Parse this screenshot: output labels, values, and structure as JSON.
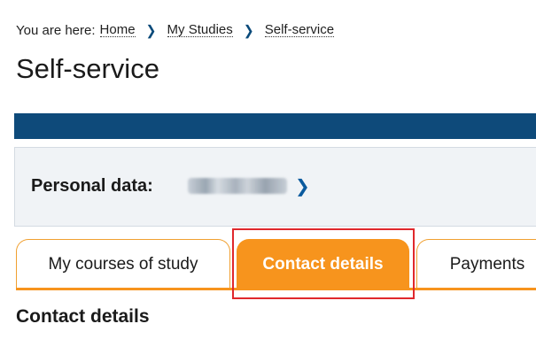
{
  "breadcrumb": {
    "prefix": "You are here:",
    "items": [
      {
        "label": "Home"
      },
      {
        "label": "My Studies"
      },
      {
        "label": "Self-service"
      }
    ],
    "separator_icon": "chevron-right-icon"
  },
  "page": {
    "title": "Self-service"
  },
  "personal": {
    "label": "Personal data:",
    "name_state": "blurred",
    "chevron_icon": "chevron-right-icon"
  },
  "tabs": [
    {
      "label": "My courses of study",
      "active": false
    },
    {
      "label": "Contact details",
      "active": true
    },
    {
      "label": "Payments",
      "active": false
    }
  ],
  "section": {
    "heading": "Contact details"
  },
  "colors": {
    "brand_blue": "#0e4a7a",
    "tab_accent": "#f7941d",
    "highlight": "#e0282c",
    "panel_bg": "#f0f3f6"
  }
}
